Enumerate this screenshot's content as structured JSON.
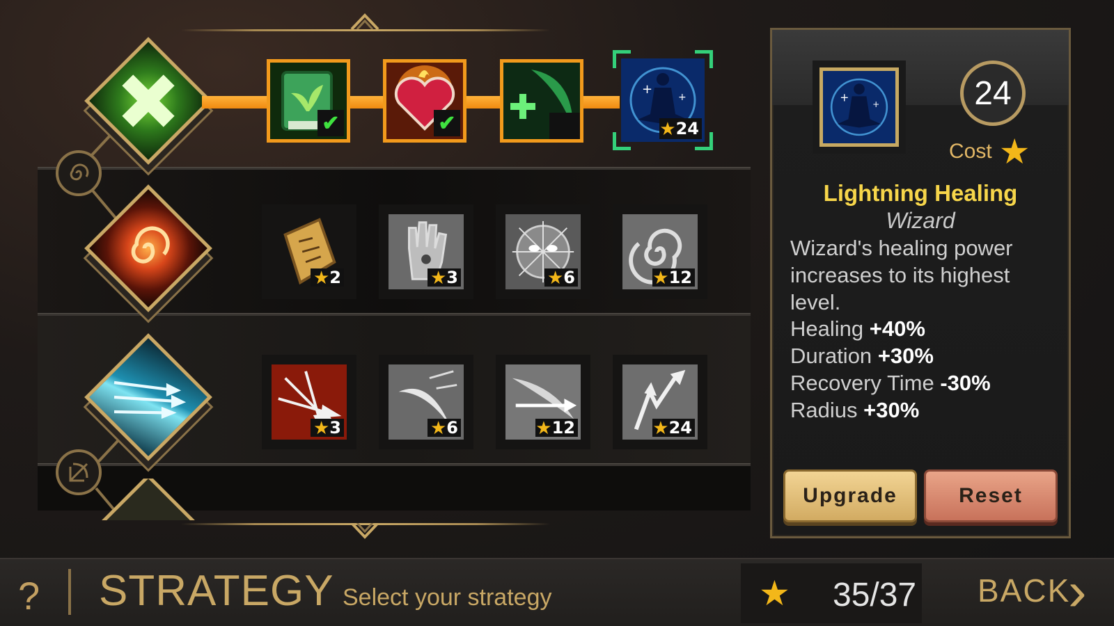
{
  "tree": {
    "rows": [
      {
        "category_icon": "healing-cross-icon",
        "skills": [
          {
            "icon": "herb-book-icon",
            "state": "owned",
            "cost": ""
          },
          {
            "icon": "flaming-heart-icon",
            "state": "owned",
            "cost": ""
          },
          {
            "icon": "green-plus-slash-icon",
            "state": "owned",
            "cost": ""
          },
          {
            "icon": "lightning-healing-icon",
            "state": "selected",
            "cost": "24"
          }
        ]
      },
      {
        "category_icon": "fire-vortex-icon",
        "skills": [
          {
            "icon": "scroll-icon",
            "state": "available",
            "cost": "2"
          },
          {
            "icon": "palm-hand-icon",
            "state": "locked",
            "cost": "3"
          },
          {
            "icon": "spiderweb-face-icon",
            "state": "locked",
            "cost": "6"
          },
          {
            "icon": "swirl-icon",
            "state": "locked",
            "cost": "12"
          }
        ]
      },
      {
        "category_icon": "arrow-volley-icon",
        "skills": [
          {
            "icon": "arrow-burst-icon",
            "state": "available",
            "cost": "3"
          },
          {
            "icon": "swoosh-icon",
            "state": "locked",
            "cost": "6"
          },
          {
            "icon": "dash-arrow-icon",
            "state": "locked",
            "cost": "12"
          },
          {
            "icon": "split-arrow-icon",
            "state": "locked",
            "cost": "24"
          }
        ]
      }
    ],
    "check_mark": "✔"
  },
  "detail": {
    "cost": "24",
    "cost_label": "Cost",
    "title": "Lightning Healing",
    "class": "Wizard",
    "description": "Wizard's healing power increases to its highest level.",
    "stats": [
      {
        "label": "Healing",
        "value": "+40%"
      },
      {
        "label": "Duration",
        "value": "+30%"
      },
      {
        "label": "Recovery Time",
        "value": "-30%"
      },
      {
        "label": "Radius",
        "value": "+30%"
      }
    ],
    "upgrade_label": "Upgrade",
    "reset_label": "Reset"
  },
  "footer": {
    "help": "?",
    "title": "STRATEGY",
    "subtitle": "Select your strategy",
    "points": "35/37",
    "back_label": "BACK"
  },
  "colors": {
    "gold": "#c9a865",
    "orange_border": "#f29a1c",
    "star": "#f3b719",
    "selected_corner": "#34d07a",
    "title_yellow": "#f7d64a"
  }
}
